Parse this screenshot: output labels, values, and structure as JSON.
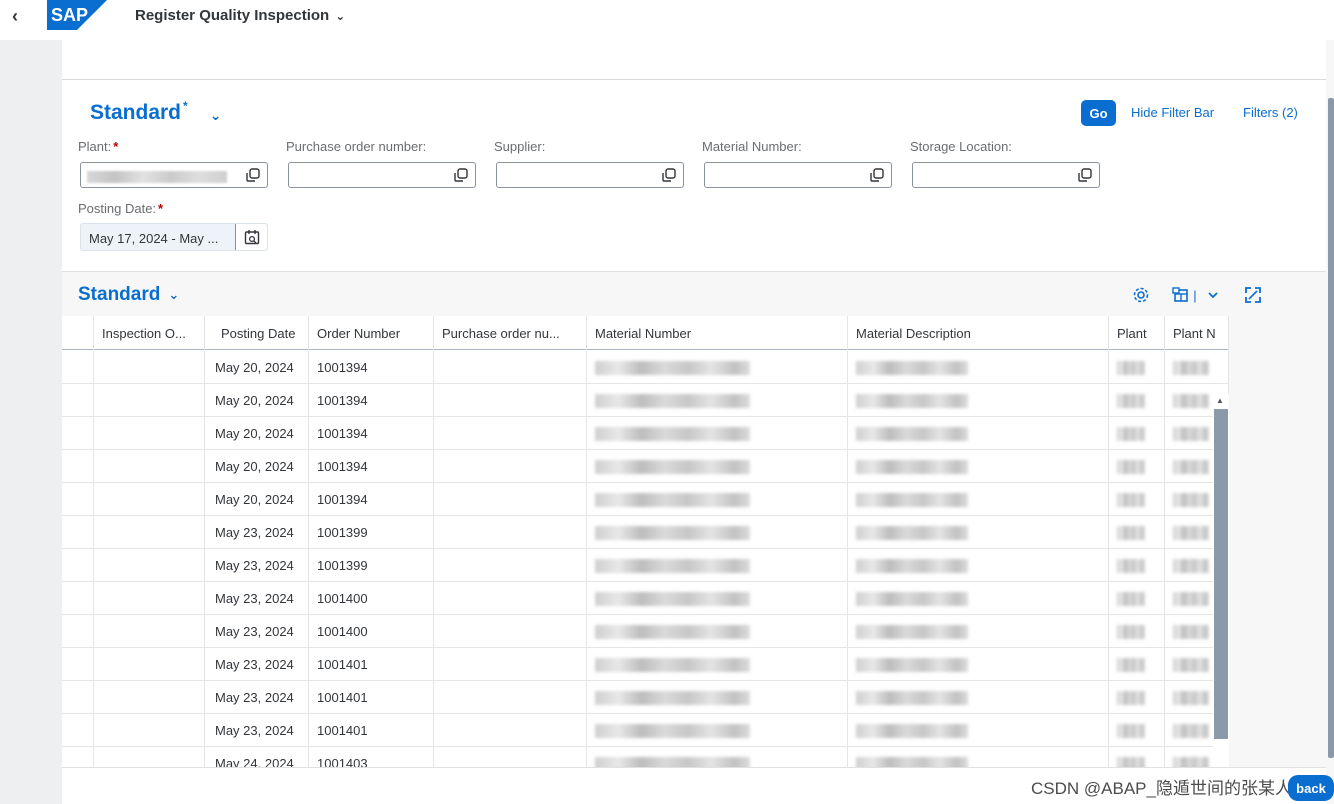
{
  "shell": {
    "title": "Register Quality Inspection",
    "logo_text": "SAP"
  },
  "filter_bar": {
    "variant_name": "Standard",
    "variant_modified": "*",
    "go_label": "Go",
    "hide_filter_bar_label": "Hide Filter Bar",
    "filters_label": "Filters (2)",
    "fields": {
      "plant": {
        "label": "Plant:",
        "required": "*",
        "value": ""
      },
      "purchase_order": {
        "label": "Purchase order number:",
        "value": ""
      },
      "supplier": {
        "label": "Supplier:",
        "value": ""
      },
      "material_number": {
        "label": "Material Number:",
        "value": ""
      },
      "storage_location": {
        "label": "Storage Location:",
        "value": ""
      },
      "posting_date": {
        "label": "Posting Date:",
        "required": "*",
        "value": "May 17, 2024 - May ..."
      }
    }
  },
  "table": {
    "variant_name": "Standard",
    "columns": [
      "Inspection O...",
      "Posting Date",
      "Order Number",
      "Purchase order nu...",
      "Material Number",
      "Material Description",
      "Plant",
      "Plant N"
    ],
    "rows": [
      {
        "posting_date": "May 20, 2024",
        "order_number": "1001394"
      },
      {
        "posting_date": "May 20, 2024",
        "order_number": "1001394"
      },
      {
        "posting_date": "May 20, 2024",
        "order_number": "1001394"
      },
      {
        "posting_date": "May 20, 2024",
        "order_number": "1001394"
      },
      {
        "posting_date": "May 20, 2024",
        "order_number": "1001394"
      },
      {
        "posting_date": "May 23, 2024",
        "order_number": "1001399"
      },
      {
        "posting_date": "May 23, 2024",
        "order_number": "1001399"
      },
      {
        "posting_date": "May 23, 2024",
        "order_number": "1001400"
      },
      {
        "posting_date": "May 23, 2024",
        "order_number": "1001400"
      },
      {
        "posting_date": "May 23, 2024",
        "order_number": "1001401"
      },
      {
        "posting_date": "May 23, 2024",
        "order_number": "1001401"
      },
      {
        "posting_date": "May 23, 2024",
        "order_number": "1001401"
      },
      {
        "posting_date": "May 24, 2024",
        "order_number": "1001403"
      }
    ]
  },
  "footer": {
    "watermark": "CSDN @ABAP_隐遁世间的张某人",
    "back_label": "back"
  },
  "colors": {
    "accent": "#0a6ed1",
    "required": "#bb0000",
    "scrollbar": "#8b99a8"
  },
  "icons": [
    "chevron-left-icon",
    "value-help-icon",
    "calendar-icon",
    "settings-icon",
    "export-icon",
    "fullscreen-icon"
  ]
}
